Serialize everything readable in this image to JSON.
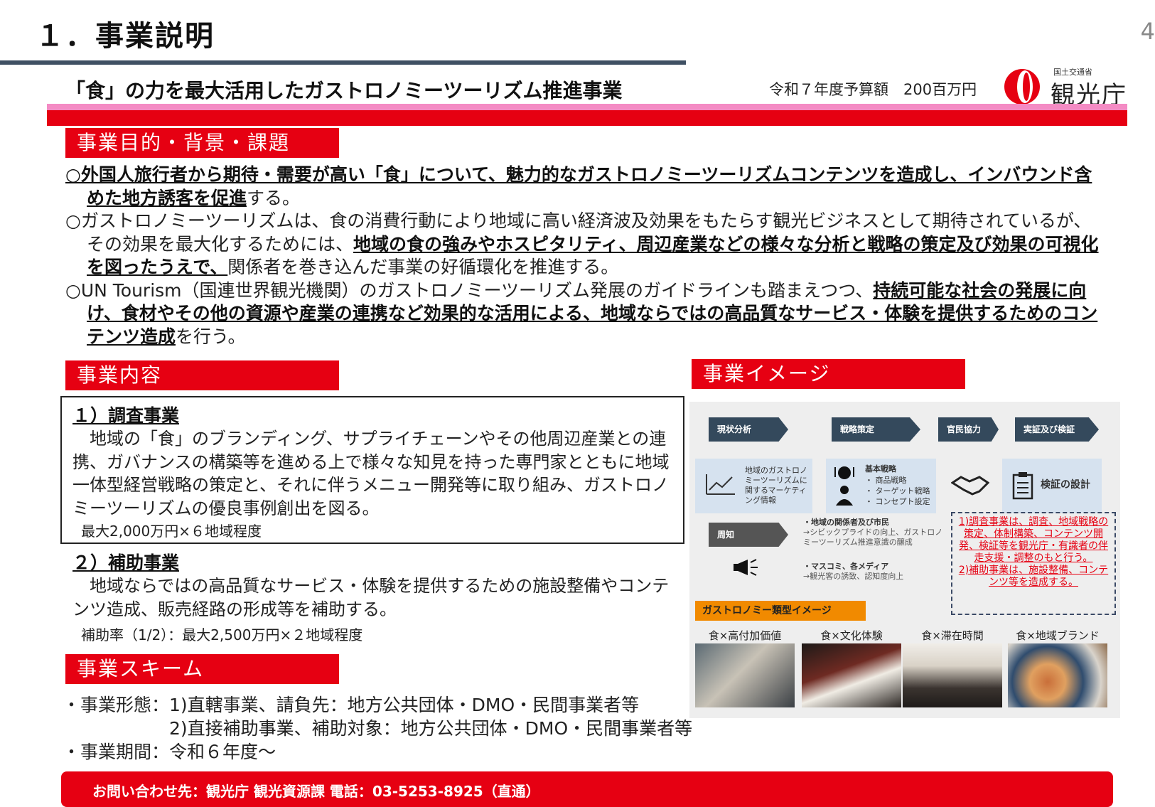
{
  "header": {
    "title": "１．事業説明",
    "page_number": "4",
    "subtitle": "「食」の力を最大活用したガストロノミーツーリズム推進事業",
    "budget": "令和７年度予算額　200百万円",
    "logo_small": "国土交通省",
    "logo_big": "観光庁",
    "logo_icon": "japan-tourism-agency-logo"
  },
  "purpose": {
    "heading": "事業目的・背景・課題",
    "p1_bold": "○外国人旅行者から期待・需要が高い「食」について、魅力的なガストロノミーツーリズムコンテンツを造成し、インバウンド含めた地方誘客を促進",
    "p1_rest": "する。",
    "p2_a": "○ガストロノミーツーリズムは、食の消費行動により地域に高い経済波及効果をもたらす観光ビジネスとして期待されているが、その効果を最大化するためには、",
    "p2_bold": "地域の食の強みやホスピタリティ、周辺産業などの様々な分析と戦略の策定及び効果の可視化を図ったうえで、",
    "p2_rest": "関係者を巻き込んだ事業の好循環化を推進する。",
    "p3_a": "○UN Tourism（国連世界観光機関）のガストロノミーツーリズム発展のガイドラインも踏まえつつ、",
    "p3_bold": "持続可能な社会の発展に向け、食材やその他の資源や産業の連携など効果的な活用による、地域ならではの高品質なサービス・体験を提供するためのコンテンツ造成",
    "p3_rest": "を行う。"
  },
  "content": {
    "heading": "事業内容",
    "item1_title": "１）調査事業",
    "item1_body": "　地域の「食」のブランディング、サプライチェーンやその他周辺産業との連携、ガバナンスの構築等を進める上で様々な知見を持った専門家とともに地域一体型経営戦略の策定と、それに伴うメニュー開発等に取り組み、ガストロノミーツーリズムの優良事例創出を図る。",
    "item1_note": "最大2,000万円×６地域程度",
    "item2_title": "２）補助事業",
    "item2_body": "　地域ならではの高品質なサービス・体験を提供するための施設整備やコンテンツ造成、販売経路の形成等を補助する。",
    "item2_note": "補助率（1/2）：最大2,500万円×２地域程度"
  },
  "scheme": {
    "heading": "事業スキーム",
    "line1": "・事業形態：1)直轄事業、請負先：地方公共団体・DMO・民間事業者等",
    "line2": "　　　　　　2)直接補助事業、補助対象：地方公共団体・DMO・民間事業者等",
    "line3": "・事業期間：令和６年度～"
  },
  "image_panel": {
    "heading": "事業イメージ",
    "steps": [
      "現状分析",
      "戦略策定",
      "官民協力",
      "実証及び検証"
    ],
    "tile1": "地域のガストロノミーツーリズムに関するマーケティング情報",
    "tile2_title": "基本戦略",
    "tile2_items": [
      "・ 商品戦略",
      "・ ターゲット戦略",
      "・ コンセプト設定"
    ],
    "tile4": "検証の設計",
    "promo": "周知",
    "promo_text1": "・地域の関係者及び市民",
    "promo_text2": "→シビックプライドの向上、ガストロノミーツーリズム推進意識の醸成",
    "promo_text3": "・マスコミ、各メディア",
    "promo_text4": "→観光客の誘致、認知度向上",
    "note1": "1)調査事業は、調査、地域戦略の策定、体制構築、コンテンツ開発、検証等を観光庁・有識者の伴走支援・調整のもと行う。",
    "note2": "2)補助事業は、施設整備、コンテンツ等を造成する。",
    "gastro_label": "ガストロノミー類型イメージ",
    "photo_labels": [
      "食×高付加価値",
      "食×文化体験",
      "食×滞在時間",
      "食×地域ブランド"
    ]
  },
  "contact": {
    "text": "お問い合わせ先：観光庁 観光資源課 電話：03-5253-8925（直通）"
  },
  "colors": {
    "accent_red": "#e60012",
    "accent_pink": "#f48bc4",
    "rule_navy": "#3f5063",
    "step_navy": "#34495c",
    "tile_blue": "#d6e2ef",
    "label_orange": "#f18a00"
  }
}
